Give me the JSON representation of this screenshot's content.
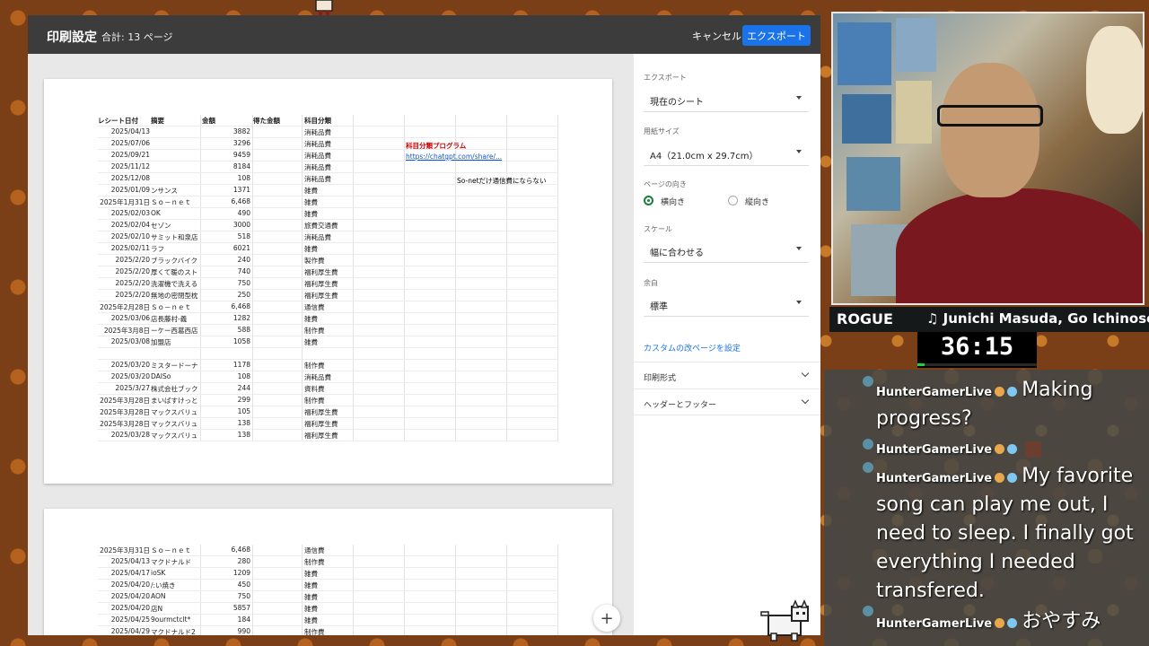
{
  "print_dialog": {
    "title": "印刷設定",
    "page_count": "合計: 13 ページ",
    "cancel_label": "キャンセル",
    "export_label": "エクスポート"
  },
  "sheet": {
    "headers": {
      "date": "レシート日付",
      "desc": "摘要",
      "amount": "金額",
      "received": "得た金額",
      "category": "科目分類"
    },
    "notes": {
      "program_title": "科目分類プログラム",
      "link": "https://chatgpt.com/share/...",
      "sonet_note": "So-netだけ通信費にならない"
    },
    "rows": [
      {
        "date": "2025/04/13",
        "desc": "",
        "amount": "3882",
        "category": "消耗品費"
      },
      {
        "date": "2025/07/06",
        "desc": "",
        "amount": "3296",
        "category": "消耗品費"
      },
      {
        "date": "2025/09/21",
        "desc": "",
        "amount": "9459",
        "category": "消耗品費"
      },
      {
        "date": "2025/11/12",
        "desc": "",
        "amount": "8184",
        "category": "消耗品費"
      },
      {
        "date": "2025/12/08",
        "desc": "",
        "amount": "108",
        "category": "消耗品費"
      },
      {
        "date": "2025/01/09",
        "desc": "ンサンス",
        "amount": "1371",
        "category": "雑費"
      },
      {
        "date": "2025年1月31日",
        "desc": "Ｓｏ－ｎｅｔ",
        "amount": "6,468",
        "category": "雑費"
      },
      {
        "date": "2025/02/03",
        "desc": "OK",
        "amount": "490",
        "category": "雑費"
      },
      {
        "date": "2025/02/04",
        "desc": "セゾン",
        "amount": "3000",
        "category": "旅費交通費"
      },
      {
        "date": "2025/02/10",
        "desc": "サミット和泉店",
        "amount": "518",
        "category": "消耗品費"
      },
      {
        "date": "2025/02/11",
        "desc": "ラフ",
        "amount": "6021",
        "category": "雑費"
      },
      {
        "date": "2025/2/20",
        "desc": "ブラックバイク",
        "amount": "240",
        "category": "製作費"
      },
      {
        "date": "2025/2/20",
        "desc": "厚くて暖のスト",
        "amount": "740",
        "category": "福利厚生費"
      },
      {
        "date": "2025/2/20",
        "desc": "洗濯機で洗える",
        "amount": "750",
        "category": "福利厚生費"
      },
      {
        "date": "2025/2/20",
        "desc": "無地の密閉型枕",
        "amount": "250",
        "category": "福利厚生費"
      },
      {
        "date": "2025年2月28日",
        "desc": "Ｓｏ－ｎｅｔ",
        "amount": "6,468",
        "category": "通信費"
      },
      {
        "date": "2025/03/06",
        "desc": "店長藤村-義",
        "amount": "1282",
        "category": "雑費"
      },
      {
        "date": "2025年3月8日",
        "desc": "ーケー西葛西店",
        "amount": "588",
        "category": "制作費"
      },
      {
        "date": "2025/03/08",
        "desc": "加盟店",
        "amount": "1058",
        "category": "雑費"
      },
      {
        "date": "",
        "desc": "",
        "amount": "",
        "category": ""
      },
      {
        "date": "2025/03/20",
        "desc": "ミスタードーナ",
        "amount": "1178",
        "category": "制作費"
      },
      {
        "date": "2025/03/20",
        "desc": "DAISo",
        "amount": "108",
        "category": "消耗品費"
      },
      {
        "date": "2025/3/27",
        "desc": "株式会社ブック",
        "amount": "244",
        "category": "資料費"
      },
      {
        "date": "2025年3月28日",
        "desc": "まいばすけっと",
        "amount": "299",
        "category": "制作費"
      },
      {
        "date": "2025年3月28日",
        "desc": "マックスバリュ",
        "amount": "105",
        "category": "福利厚生費"
      },
      {
        "date": "2025年3月28日",
        "desc": "マックスバリュ",
        "amount": "138",
        "category": "福利厚生費"
      },
      {
        "date": "2025/03/28",
        "desc": "マックスバリュ",
        "amount": "138",
        "category": "福利厚生費"
      }
    ],
    "page2_rows": [
      {
        "date": "2025年3月31日",
        "desc": "Ｓｏ－ｎｅｔ",
        "amount": "6,468",
        "category": "通信費"
      },
      {
        "date": "2025/04/13",
        "desc": "マクドナルド",
        "amount": "280",
        "category": "制作費"
      },
      {
        "date": "2025/04/17",
        "desc": "ioSK",
        "amount": "1209",
        "category": "雑費"
      },
      {
        "date": "2025/04/20",
        "desc": "/:い焼き",
        "amount": "450",
        "category": "雑費"
      },
      {
        "date": "2025/04/20",
        "desc": "AON",
        "amount": "750",
        "category": "雑費"
      },
      {
        "date": "2025/04/20",
        "desc": "店N",
        "amount": "5857",
        "category": "雑費"
      },
      {
        "date": "2025/04/25",
        "desc": "9ourmctclt*",
        "amount": "184",
        "category": "雑費"
      },
      {
        "date": "2025/04/29",
        "desc": "マクドナルド2",
        "amount": "990",
        "category": "制作費"
      }
    ]
  },
  "settings": {
    "export_label": "エクスポート",
    "export_value": "現在のシート",
    "paper_label": "用紙サイズ",
    "paper_value": "A4（21.0cm x 29.7cm）",
    "orientation_label": "ページの向き",
    "landscape": "横向き",
    "portrait": "縦向き",
    "scale_label": "スケール",
    "scale_value": "幅に合わせる",
    "margin_label": "余白",
    "margin_value": "標準",
    "custom_break": "カスタムの改ページを設定",
    "format_section": "印刷形式",
    "header_footer_section": "ヘッダーとフッター"
  },
  "stream": {
    "now_playing_left": "ROGUE",
    "now_playing_right": "♫ Junichi Masuda, Go Ichinose",
    "timer": "36:15",
    "timer_progress": 0.06,
    "accent_green": "#19d43a",
    "chat": [
      {
        "user": "HunterGamerLive",
        "message": "Making progress?"
      },
      {
        "user": "HunterGamerLive",
        "message": ""
      },
      {
        "user": "HunterGamerLive",
        "message": "My favorite song can play me out, I need to sleep. I finally got everything I needed transfered."
      },
      {
        "user": "HunterGamerLive",
        "message": "おやすみ"
      }
    ]
  }
}
